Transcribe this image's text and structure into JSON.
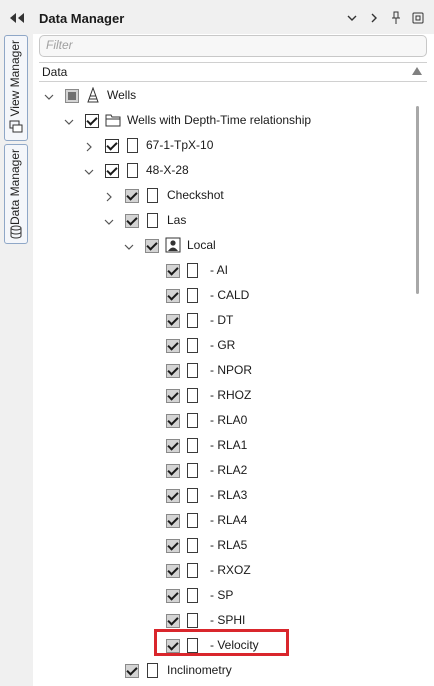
{
  "side_tabs": [
    {
      "label": "View Manager",
      "icon": "view-manager-icon"
    },
    {
      "label": "Data Manager",
      "icon": "database-icon"
    }
  ],
  "panel": {
    "title": "Data Manager",
    "filter_placeholder": "Filter",
    "column_header": "Data"
  },
  "tree": [
    {
      "label": "Wells",
      "checkbox": "partial",
      "icon": "well-derrick-icon",
      "expanded": true
    },
    {
      "label": "Wells with Depth-Time relationship",
      "checkbox": "checked",
      "icon": "folder-icon",
      "expanded": true
    },
    {
      "label": "67-1-TpX-10",
      "checkbox": "checked",
      "icon": "document-icon",
      "expanded": false
    },
    {
      "label": "48-X-28",
      "checkbox": "checked",
      "icon": "document-icon",
      "expanded": true
    },
    {
      "label": "Checkshot",
      "checkbox": "checked-gray",
      "icon": "document-icon",
      "expanded": false
    },
    {
      "label": "Las",
      "checkbox": "checked-gray",
      "icon": "document-icon",
      "expanded": true
    },
    {
      "label": "Local",
      "checkbox": "checked-gray",
      "icon": "user-icon",
      "expanded": true
    },
    {
      "label": "- AI",
      "checkbox": "checked-gray",
      "icon": "document-icon"
    },
    {
      "label": "- CALD",
      "checkbox": "checked-gray",
      "icon": "document-icon"
    },
    {
      "label": "- DT",
      "checkbox": "checked-gray",
      "icon": "document-icon"
    },
    {
      "label": "- GR",
      "checkbox": "checked-gray",
      "icon": "document-icon"
    },
    {
      "label": "- NPOR",
      "checkbox": "checked-gray",
      "icon": "document-icon"
    },
    {
      "label": "- RHOZ",
      "checkbox": "checked-gray",
      "icon": "document-icon"
    },
    {
      "label": "- RLA0",
      "checkbox": "checked-gray",
      "icon": "document-icon"
    },
    {
      "label": "- RLA1",
      "checkbox": "checked-gray",
      "icon": "document-icon"
    },
    {
      "label": "- RLA2",
      "checkbox": "checked-gray",
      "icon": "document-icon"
    },
    {
      "label": "- RLA3",
      "checkbox": "checked-gray",
      "icon": "document-icon"
    },
    {
      "label": "- RLA4",
      "checkbox": "checked-gray",
      "icon": "document-icon"
    },
    {
      "label": "- RLA5",
      "checkbox": "checked-gray",
      "icon": "document-icon"
    },
    {
      "label": "- RXOZ",
      "checkbox": "checked-gray",
      "icon": "document-icon"
    },
    {
      "label": "- SP",
      "checkbox": "checked-gray",
      "icon": "document-icon"
    },
    {
      "label": "- SPHI",
      "checkbox": "checked-gray",
      "icon": "document-icon"
    },
    {
      "label": "- Velocity",
      "checkbox": "checked-gray",
      "icon": "document-icon",
      "highlighted": true
    },
    {
      "label": "Inclinometry",
      "checkbox": "checked-gray",
      "icon": "document-icon"
    }
  ],
  "colors": {
    "highlight": "#d9262c",
    "tab_border": "#8fa7c7"
  }
}
